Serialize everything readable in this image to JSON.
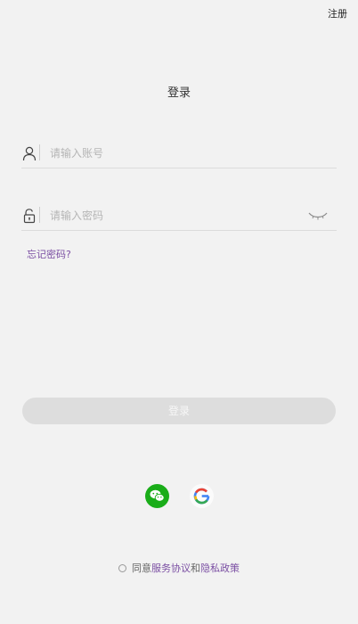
{
  "header": {
    "register_label": "注册"
  },
  "title": "登录",
  "account": {
    "placeholder": "请输入账号",
    "icon": "user-icon"
  },
  "password": {
    "placeholder": "请输入密码",
    "icon": "unlock-icon",
    "toggle_icon": "eye-closed-icon"
  },
  "forgot_label": "忘记密码?",
  "login_button_label": "登录",
  "social": [
    {
      "name": "WeChat",
      "icon": "wechat-icon",
      "color": "#1aad19"
    },
    {
      "name": "Google",
      "icon": "google-icon"
    }
  ],
  "agreement": {
    "prefix": "同意",
    "terms": "服务协议",
    "and": "和",
    "privacy": "隐私政策"
  },
  "colors": {
    "background": "#f2f2f2",
    "accent": "#7b4fa3",
    "button_disabled": "#dddddd"
  }
}
